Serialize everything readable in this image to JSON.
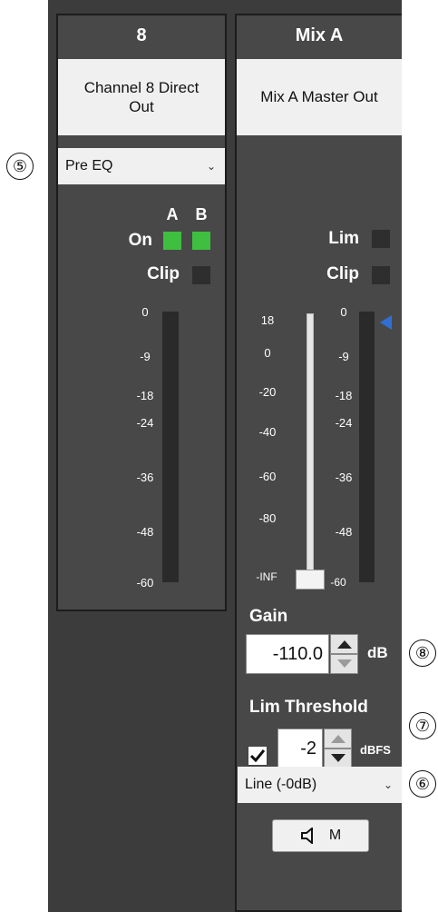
{
  "callouts": {
    "c5": "⑤",
    "c6": "⑥",
    "c7": "⑦",
    "c8": "⑧"
  },
  "channel8": {
    "title": "8",
    "name_line1": "Channel 8 Direct",
    "name_line2": "Out",
    "tap_point": "Pre EQ",
    "col_a": "A",
    "col_b": "B",
    "on_label": "On",
    "clip_label": "Clip",
    "on_a": true,
    "on_b": true,
    "meter_scale": [
      "0",
      "-9",
      "-18",
      "-24",
      "-36",
      "-48",
      "-60"
    ]
  },
  "mixA": {
    "title": "Mix A",
    "name": "Mix A Master Out",
    "lim_label": "Lim",
    "clip_label": "Clip",
    "fader_scale": [
      "18",
      "0",
      "-20",
      "-40",
      "-60",
      "-80",
      "-INF"
    ],
    "meter_scale": [
      "0",
      "-9",
      "-18",
      "-24",
      "-36",
      "-48",
      "-60"
    ],
    "gain_label": "Gain",
    "gain_value": "-110.0",
    "gain_unit": "dB",
    "lim_threshold_label": "Lim Threshold",
    "lim_threshold_enabled": true,
    "lim_threshold_value": "-2",
    "lim_threshold_unit": "dBFS",
    "output_level": "Line (-0dB)",
    "mute_label": "M"
  },
  "colors": {
    "led_on": "#3fbf3f",
    "led_off": "#2e2e2e",
    "threshold_marker": "#2f6fd6",
    "strip_bg": "#484848"
  }
}
